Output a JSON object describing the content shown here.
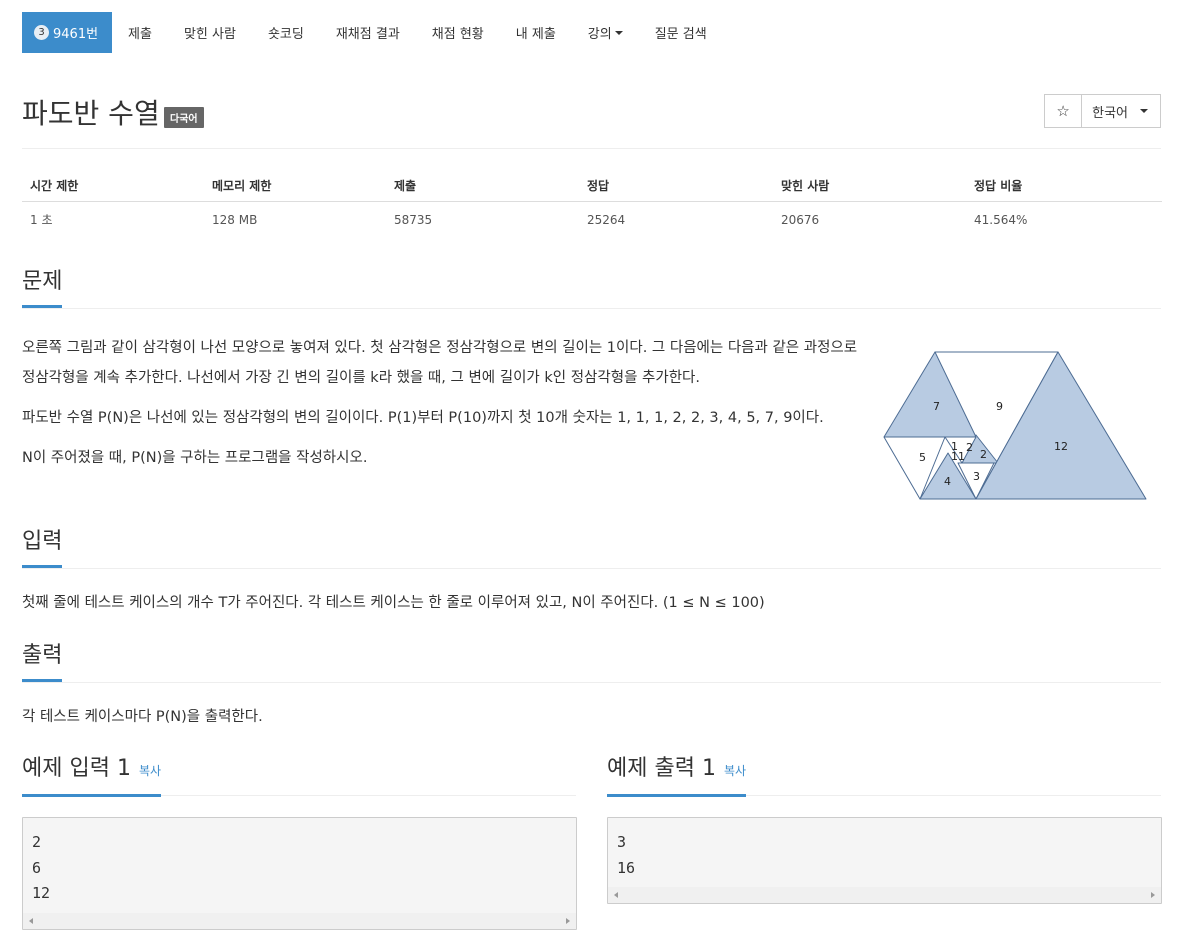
{
  "nav": {
    "problem_badge": "3",
    "problem_id": "9461번",
    "items": [
      "제출",
      "맞힌 사람",
      "숏코딩",
      "재채점 결과",
      "채점 현황",
      "내 제출",
      "강의",
      "질문 검색"
    ]
  },
  "header": {
    "title": "파도반 수열",
    "multilang_badge": "다국어",
    "star_icon": "☆",
    "language": "한국어"
  },
  "info_table": {
    "headers": [
      "시간 제한",
      "메모리 제한",
      "제출",
      "정답",
      "맞힌 사람",
      "정답 비율"
    ],
    "values": [
      "1 초",
      "128 MB",
      "58735",
      "25264",
      "20676",
      "41.564%"
    ]
  },
  "problem": {
    "heading": "문제",
    "p1": "오른쪽 그림과 같이 삼각형이 나선 모양으로 놓여져 있다. 첫 삼각형은 정삼각형으로 변의 길이는 1이다. 그 다음에는 다음과 같은 과정으로 정삼각형을 계속 추가한다. 나선에서 가장 긴 변의 길이를 k라 했을 때, 그 변에 길이가 k인 정삼각형을 추가한다.",
    "p2": "파도반 수열 P(N)은 나선에 있는 정삼각형의 변의 길이이다. P(1)부터 P(10)까지 첫 10개 숫자는 1, 1, 1, 2, 2, 3, 4, 5, 7, 9이다.",
    "p3": "N이 주어졌을 때, P(N)을 구하는 프로그램을 작성하시오.",
    "figure_labels": [
      "7",
      "9",
      "12",
      "5",
      "4",
      "3",
      "2",
      "2",
      "1",
      "1",
      "1"
    ]
  },
  "input": {
    "heading": "입력",
    "text": "첫째 줄에 테스트 케이스의 개수 T가 주어진다. 각 테스트 케이스는 한 줄로 이루어져 있고, N이 주어진다. (1 ≤ N ≤ 100)"
  },
  "output": {
    "heading": "출력",
    "text": "각 테스트 케이스마다 P(N)을 출력한다."
  },
  "sample_input": {
    "heading": "예제 입력 1",
    "copy_label": "복사",
    "lines": [
      "2",
      "6",
      "12"
    ]
  },
  "sample_output": {
    "heading": "예제 출력 1",
    "copy_label": "복사",
    "lines": [
      "3",
      "16"
    ]
  }
}
